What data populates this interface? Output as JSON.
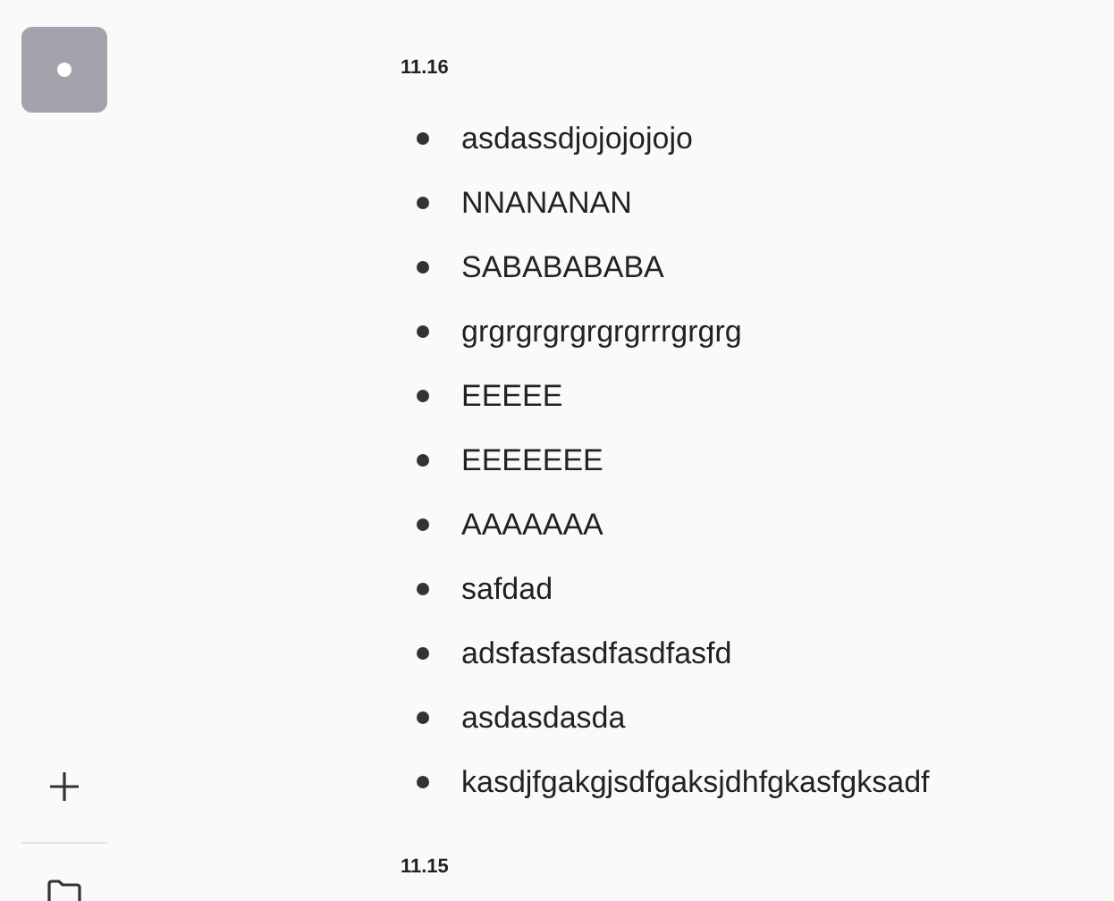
{
  "sidebar": {
    "avatar": {
      "kind": "dot"
    }
  },
  "groups": [
    {
      "date": "11.16",
      "items": [
        "asdassdjojojojojo",
        "NNANANAN",
        "SABABABABA",
        "grgrgrgrgrgrgrrrgrgrg",
        "EEEEE",
        "EEEEEEE",
        "AAAAAAA",
        "safdad",
        "adsfasfasdfasdfasfd",
        "asdasdasda",
        "kasdjfgakgjsdfgaksjdhfgkasfgksadf"
      ]
    },
    {
      "date": "11.15"
    }
  ]
}
